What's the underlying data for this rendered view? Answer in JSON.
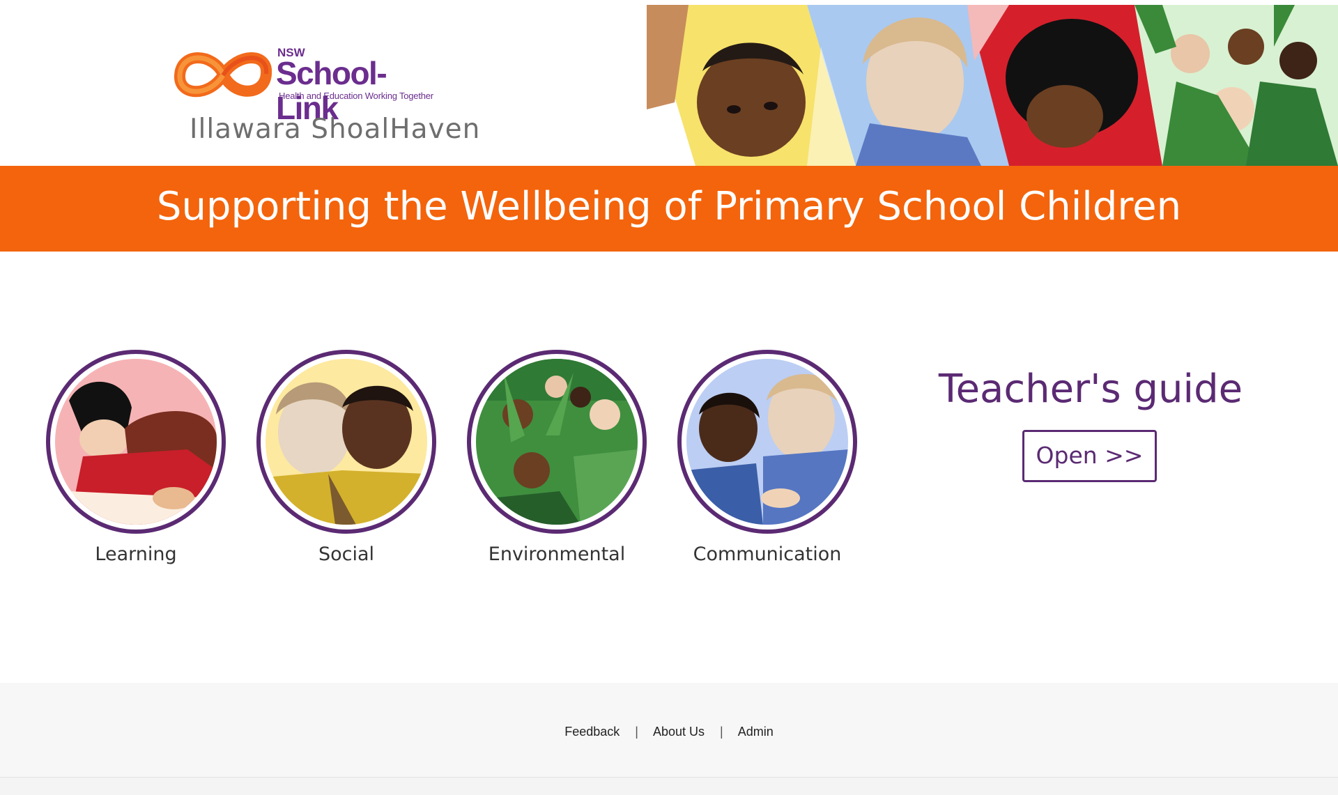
{
  "header": {
    "brand_small": "NSW",
    "brand_name": "School-Link",
    "brand_tagline": "Health and Education Working Together",
    "region": "Illawara ShoalHaven"
  },
  "banner": {
    "title": "Supporting the Wellbeing of Primary School Children"
  },
  "categories": [
    {
      "label": "Learning",
      "icon": "children-learning-illustration"
    },
    {
      "label": "Social",
      "icon": "children-social-illustration"
    },
    {
      "label": "Environmental",
      "icon": "children-environment-illustration"
    },
    {
      "label": "Communication",
      "icon": "children-communication-illustration"
    }
  ],
  "guide": {
    "title": "Teacher's guide",
    "button_label": "Open >>"
  },
  "footer": {
    "links": [
      "Feedback",
      "About Us",
      "Admin"
    ],
    "separator": "|"
  },
  "colors": {
    "accent_orange": "#f3640c",
    "brand_purple": "#5b2a73",
    "footer_bg": "#f7f7f8"
  }
}
